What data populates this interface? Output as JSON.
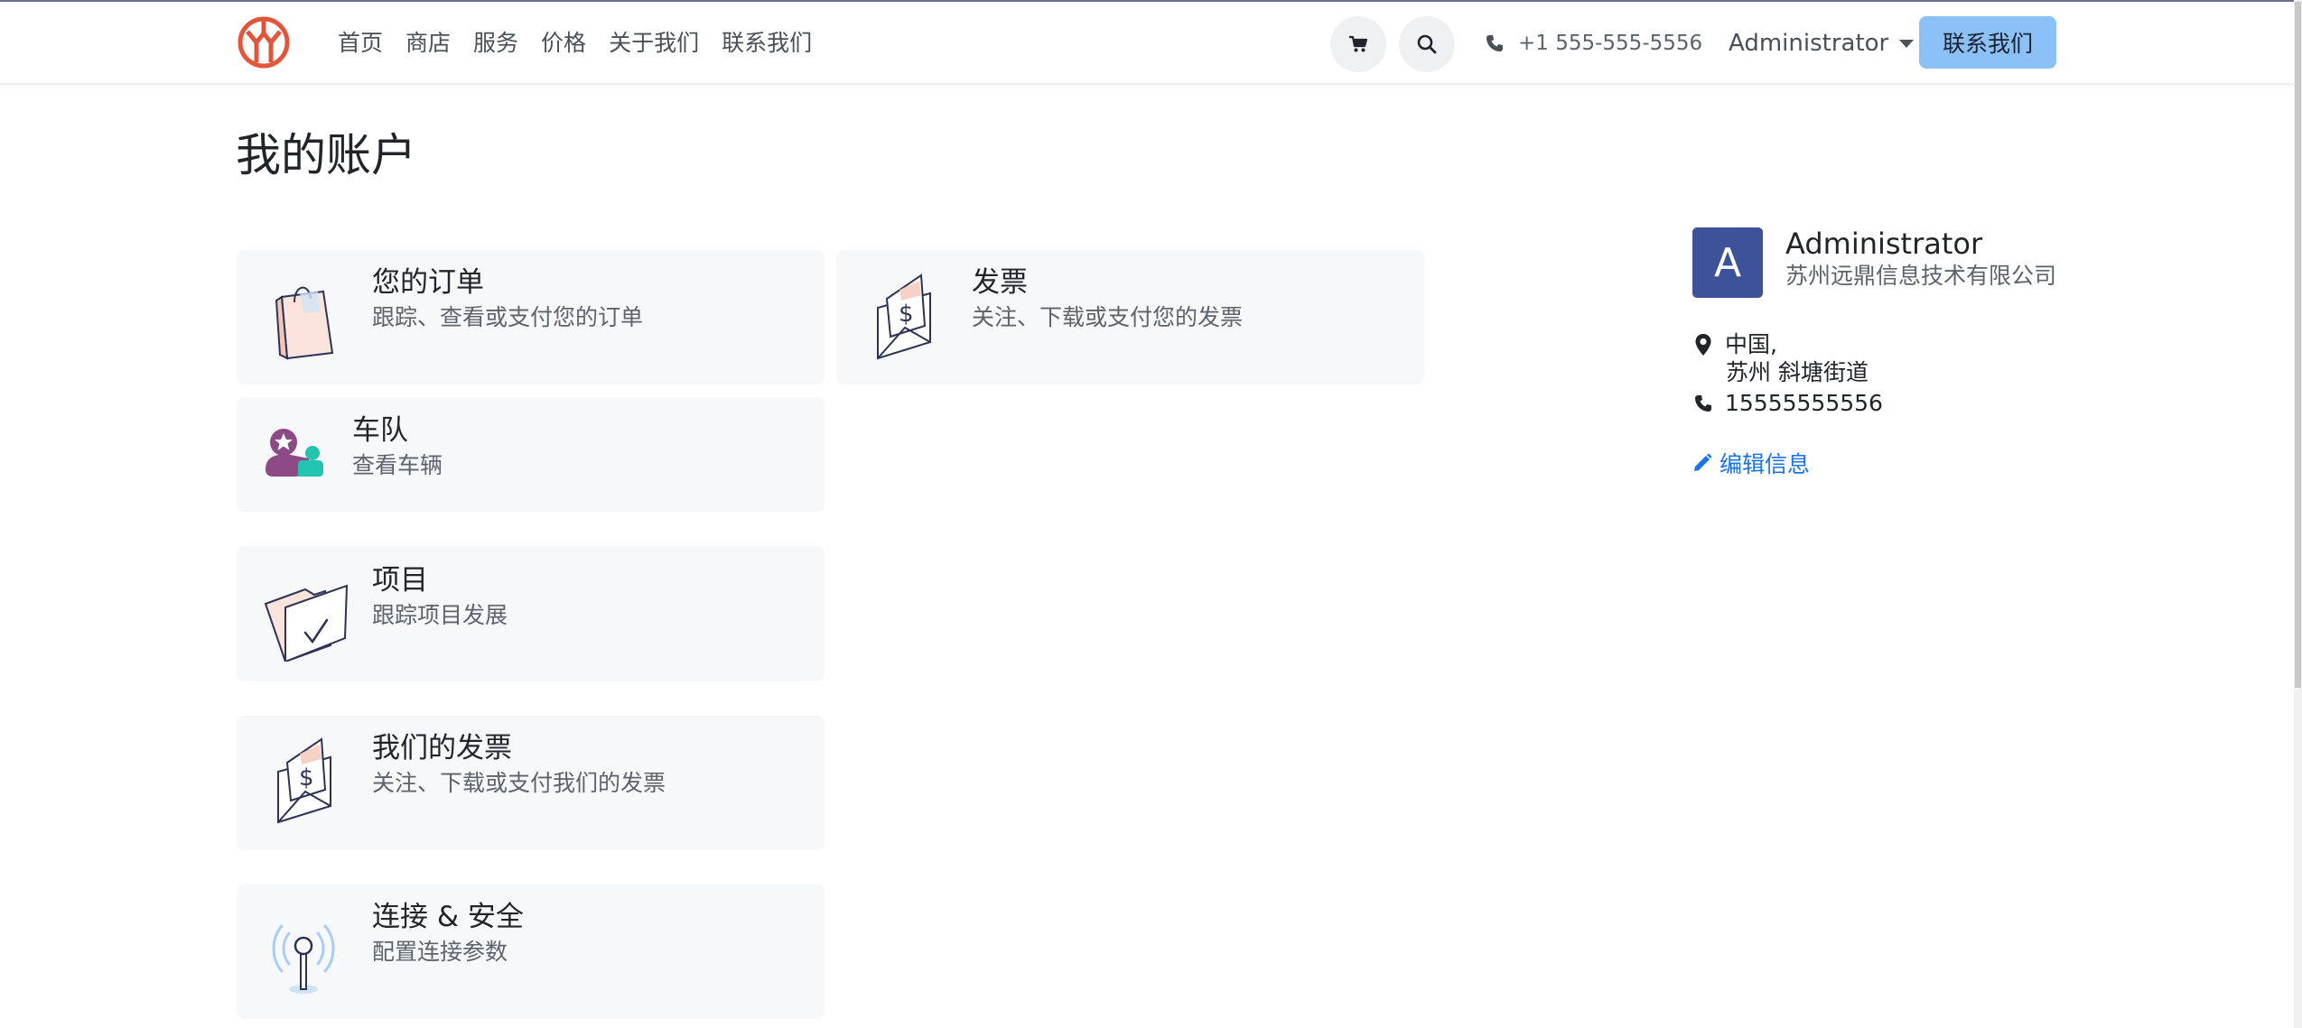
{
  "nav": {
    "items": [
      "首页",
      "商店",
      "服务",
      "价格",
      "关于我们",
      "联系我们"
    ]
  },
  "header": {
    "phone": "+1 555-555-5556",
    "user_menu": "Administrator",
    "contact_button": "联系我们"
  },
  "main": {
    "title": "我的账户",
    "cards": [
      {
        "title": "您的订单",
        "desc": "跟踪、查看或支付您的订单",
        "icon": "shopping-bag-icon"
      },
      {
        "title": "发票",
        "desc": "关注、下载或支付您的发票",
        "icon": "invoice-envelope-icon"
      },
      {
        "title": "车队",
        "desc": "查看车辆",
        "icon": "fleet-icon"
      },
      {
        "title": "项目",
        "desc": "跟踪项目发展",
        "icon": "project-folder-icon"
      },
      {
        "title": "我们的发票",
        "desc": "关注、下载或支付我们的发票",
        "icon": "invoice-envelope-icon"
      },
      {
        "title": "连接 & 安全",
        "desc": "配置连接参数",
        "icon": "antenna-icon"
      }
    ]
  },
  "profile": {
    "avatar_letter": "A",
    "name": "Administrator",
    "company": "苏州远鼎信息技术有限公司",
    "address_line1": "中国,",
    "address_line2": "苏州 斜塘街道",
    "phone": "15555555556",
    "edit_label": "编辑信息"
  },
  "colors": {
    "brand": "#e2553b",
    "primary_button": "#8cc1f7",
    "link": "#1a73e8",
    "avatar": "#3e5299"
  }
}
